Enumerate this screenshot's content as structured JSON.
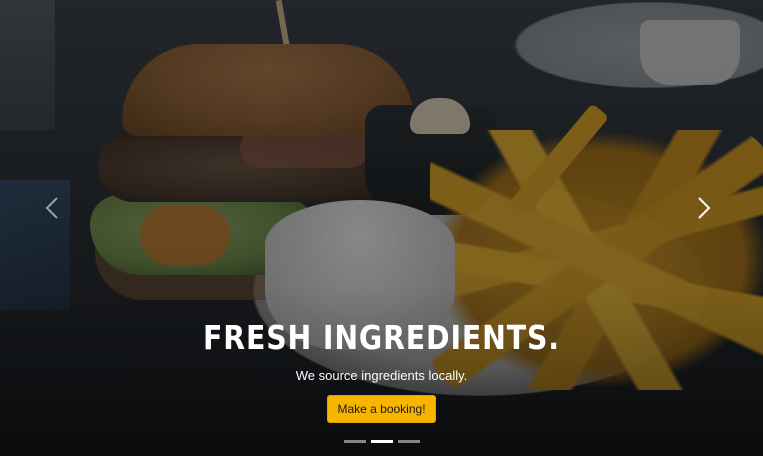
{
  "carousel": {
    "slide": {
      "title": "FRESH INGREDIENTS.",
      "subtitle": "We source ingredients locally.",
      "button_label": "Make a booking!"
    },
    "controls": {
      "prev_icon": "chevron-left-icon",
      "next_icon": "chevron-right-icon"
    },
    "indicators": {
      "count": 3,
      "active_index": 1
    }
  },
  "colors": {
    "accent": "#f7b500",
    "text": "#ffffff",
    "indicator_active": "#ffffff",
    "indicator_inactive": "#9a9a9a"
  }
}
